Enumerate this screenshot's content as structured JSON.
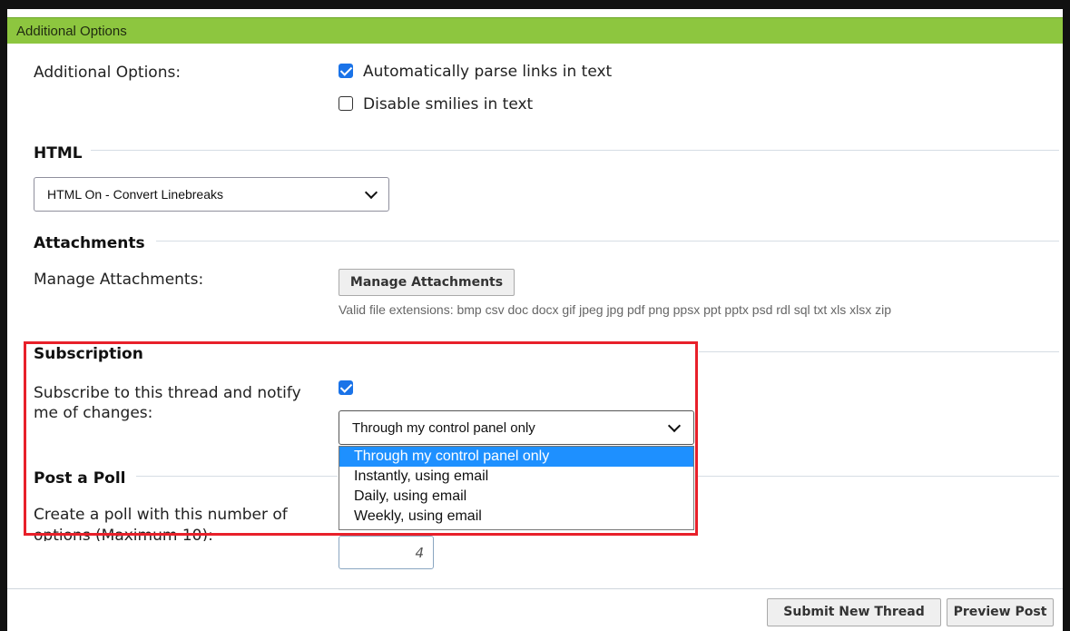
{
  "header": {
    "title": "Additional Options"
  },
  "additional_options": {
    "label": "Additional Options:",
    "parse_links": {
      "label": "Automatically parse links in text",
      "checked": true
    },
    "disable_smilies": {
      "label": "Disable smilies in text",
      "checked": false
    }
  },
  "html_section": {
    "title": "HTML",
    "select_value": "HTML On - Convert Linebreaks"
  },
  "attachments": {
    "title": "Attachments",
    "label": "Manage Attachments:",
    "button_label": "Manage Attachments",
    "valid_extensions": "Valid file extensions: bmp csv doc docx gif jpeg jpg pdf png ppsx ppt pptx psd rdl sql txt xls xlsx zip"
  },
  "subscription": {
    "title": "Subscription",
    "label_line1": "Subscribe to this thread and notify",
    "label_line2": "me of changes:",
    "checked": true,
    "select_value": "Through my control panel only",
    "options": [
      "Through my control panel only",
      "Instantly, using email",
      "Daily, using email",
      "Weekly, using email"
    ]
  },
  "poll": {
    "title": "Post a Poll",
    "label_line1": "Create a poll with this number of",
    "label_line2": "options (Maximum 10):",
    "value": "4"
  },
  "footer": {
    "submit_label": "Submit New Thread",
    "preview_label": "Preview Post"
  },
  "colors": {
    "header_bg": "#8dc63f",
    "checkbox_accent": "#1a73e8",
    "dropdown_selected": "#1e90ff",
    "highlight_border": "#e8202a"
  }
}
